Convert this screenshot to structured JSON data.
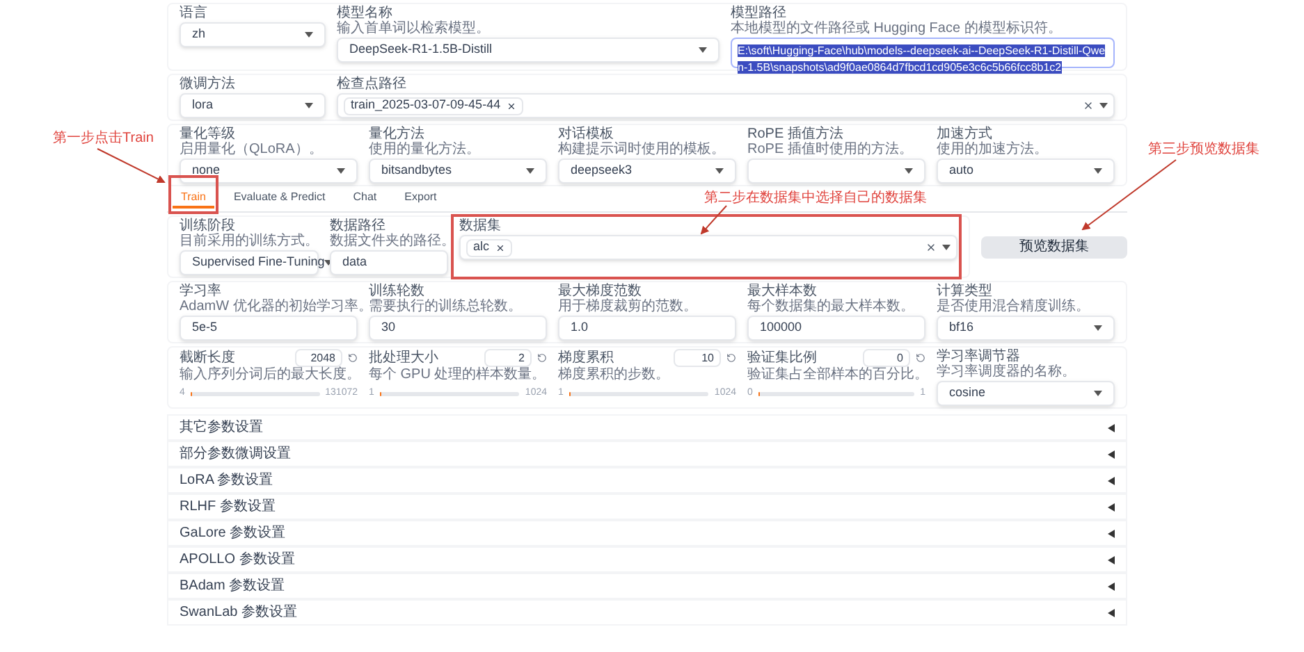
{
  "top_rows": [
    {
      "fields": [
        {
          "kind": "select",
          "label": "语言",
          "value": "zh"
        },
        {
          "kind": "select",
          "label": "模型名称",
          "hint": "输入首单词以检索模型。",
          "value": "DeepSeek-R1-1.5B-Distill"
        },
        {
          "kind": "textarea",
          "label": "模型路径",
          "hint": "本地模型的文件路径或 Hugging Face 的模型标识符。",
          "value": "E:\\soft\\Hugging-Face\\hub\\models--deepseek-ai--DeepSeek-R1-Distill-Qwen-1.5B\\snapshots\\ad9f0ae0864d7fbcd1cd905e3c6c5b66fcc8b1c2",
          "selected": true
        }
      ]
    },
    {
      "fields": [
        {
          "kind": "select",
          "label": "微调方法",
          "value": "lora"
        },
        {
          "kind": "tags",
          "label": "检查点路径",
          "tags": [
            "train_2025-03-07-09-45-44"
          ]
        }
      ]
    },
    {
      "fields": [
        {
          "kind": "select",
          "label": "量化等级",
          "hint": "启用量化（QLoRA）。",
          "value": "none"
        },
        {
          "kind": "select",
          "label": "量化方法",
          "hint": "使用的量化方法。",
          "value": "bitsandbytes"
        },
        {
          "kind": "select",
          "label": "对话模板",
          "hint": "构建提示词时使用的模板。",
          "value": "deepseek3"
        },
        {
          "kind": "select",
          "label": "RoPE 插值方法",
          "hint": "RoPE 插值时使用的方法。"
        },
        {
          "kind": "select",
          "label": "加速方式",
          "hint": "使用的加速方法。",
          "value": "auto"
        }
      ]
    }
  ],
  "tabs": [
    {
      "label": "Train",
      "selected": true
    },
    {
      "label": "Evaluate & Predict",
      "selected": false
    },
    {
      "label": "Chat",
      "selected": false
    },
    {
      "label": "Export",
      "selected": false
    }
  ],
  "train_rows": [
    {
      "fields": [
        {
          "kind": "select",
          "label": "训练阶段",
          "hint": "目前采用的训练方式。",
          "value": "Supervised Fine-Tuning"
        },
        {
          "kind": "text",
          "label": "数据路径",
          "hint": "数据文件夹的路径。",
          "value": "data"
        },
        {
          "kind": "tags",
          "label": "数据集",
          "tags": [
            "alc"
          ]
        }
      ],
      "button": "预览数据集"
    },
    {
      "fields": [
        {
          "kind": "text",
          "label": "学习率",
          "hint": "AdamW 优化器的初始学习率。",
          "value": "5e-5"
        },
        {
          "kind": "text",
          "label": "训练轮数",
          "hint": "需要执行的训练总轮数。",
          "value": "30"
        },
        {
          "kind": "text",
          "label": "最大梯度范数",
          "hint": "用于梯度裁剪的范数。",
          "value": "1.0"
        },
        {
          "kind": "text",
          "label": "最大样本数",
          "hint": "每个数据集的最大样本数。",
          "value": "100000"
        },
        {
          "kind": "select",
          "label": "计算类型",
          "hint": "是否使用混合精度训练。",
          "value": "bf16"
        }
      ]
    },
    {
      "fields": [
        {
          "kind": "slider",
          "label": "截断长度",
          "hint": "输入序列分词后的最大长度。",
          "value": "2048",
          "min": "4",
          "max": "131072",
          "level": 0.016
        },
        {
          "kind": "slider",
          "label": "批处理大小",
          "hint": "每个 GPU 处理的样本数量。",
          "value": "2",
          "min": "1",
          "max": "1024",
          "level": 0.001
        },
        {
          "kind": "slider",
          "label": "梯度累积",
          "hint": "梯度累积的步数。",
          "value": "10",
          "min": "1",
          "max": "1024",
          "level": 0.009
        },
        {
          "kind": "slider",
          "label": "验证集比例",
          "hint": "验证集占全部样本的百分比。",
          "value": "0",
          "min": "0",
          "max": "1",
          "level": 0
        },
        {
          "kind": "select",
          "label": "学习率调节器",
          "hint": "学习率调度器的名称。",
          "value": "cosine"
        }
      ]
    }
  ],
  "accordions": [
    {
      "label": "其它参数设置",
      "expanded": false
    },
    {
      "label": "部分参数微调设置",
      "expanded": false
    },
    {
      "label": "LoRA 参数设置",
      "expanded": false
    },
    {
      "label": "RLHF 参数设置",
      "expanded": false
    },
    {
      "label": "GaLore 参数设置",
      "expanded": false
    },
    {
      "label": "APOLLO 参数设置",
      "expanded": false
    },
    {
      "label": "BAdam 参数设置",
      "expanded": false
    },
    {
      "label": "SwanLab 参数设置",
      "expanded": false
    }
  ],
  "annotations": [
    {
      "text": "第一步点击Train"
    },
    {
      "text": "第二步在数据集中选择自己的数据集"
    },
    {
      "text": "第三步预览数据集"
    }
  ]
}
